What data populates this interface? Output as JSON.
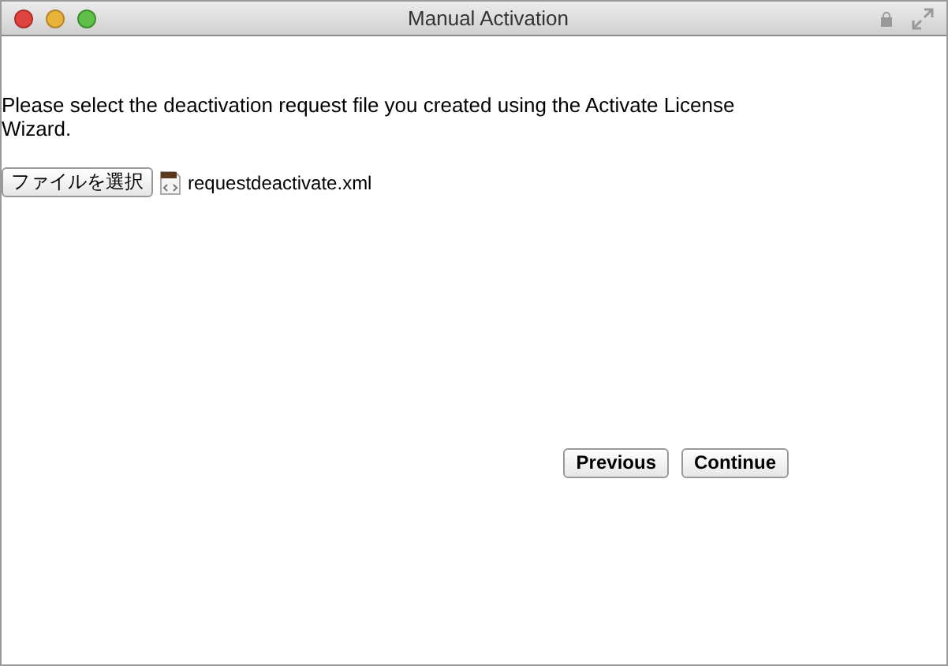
{
  "window": {
    "title": "Manual Activation"
  },
  "instruction": "Please select the deactivation request file you created using the Activate License Wizard.",
  "file_picker": {
    "button": "ファイルを選択",
    "file_name": "requestdeactivate.xml"
  },
  "buttons": [
    "Previous",
    "Continue"
  ]
}
